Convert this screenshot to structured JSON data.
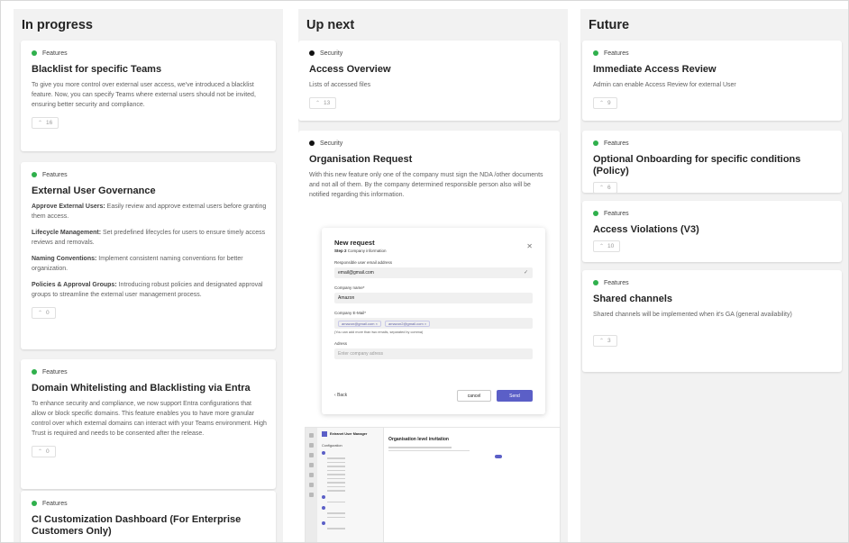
{
  "columns": [
    {
      "title": "In progress",
      "cards": [
        {
          "tag": "Features",
          "title": "Blacklist for specific Teams",
          "description": "To give you more control over external user access, we've introduced a blacklist feature. Now, you can specify Teams where external users should not be invited, ensuring better security and compliance.",
          "votes": "16"
        },
        {
          "tag": "Features",
          "title": "External User Governance",
          "paragraphs": [
            {
              "bold": "Approve External Users:",
              "text": " Easily review and approve external users before granting them access."
            },
            {
              "bold": "Lifecycle Management:",
              "text": " Set predefined lifecycles for users to ensure timely access reviews and removals."
            },
            {
              "bold": "Naming Conventions:",
              "text": " Implement consistent naming conventions for better organization."
            },
            {
              "bold": "Policies & Approval Groups:",
              "text": " Introducing robust policies and designated approval groups to streamline the external user management process."
            }
          ],
          "votes": "0"
        },
        {
          "tag": "Features",
          "title": "Domain Whitelisting and Blacklisting via Entra",
          "description": "To enhance security and compliance, we now support Entra configurations that allow or block specific domains. This feature enables you to have more granular control over which external domains can interact with your Teams environment. High Trust is required and needs to be consented after the release.",
          "votes": "0"
        },
        {
          "tag": "Features",
          "title": "CI Customization Dashboard (For Enterprise Customers Only)"
        }
      ]
    },
    {
      "title": "Up next",
      "cards": [
        {
          "tag": "Security",
          "title": "Access Overview",
          "description": "Lists of accessed files",
          "votes": "13"
        },
        {
          "tag": "Security",
          "title": "Organisation Request",
          "description": "With this new feature only one of the company must sign the NDA /other documents and not all of them. By the company determined responsible person also will be notified regarding this information.",
          "modal": {
            "title": "New request",
            "step_bold": "Step 2",
            "step_text": "Company information",
            "email_label": "Responsible user email address",
            "email_value": "email@gmail.com",
            "company_label": "Company name*",
            "company_value": "Amazon",
            "emails_label": "Company E-Mail*",
            "chip1": "amazon@gmail.com",
            "chip2": "amazon2@gmail.com",
            "emails_hint": "(You can add more than two emails, separated by comma)",
            "address_label": "Adress",
            "address_placeholder": "Enter company adress",
            "back": "Back",
            "cancel": "cancel",
            "send": "Send"
          },
          "app": {
            "brand": "Extranet User Manager",
            "section": "Configuration",
            "main_title": "Organisation level invitation"
          }
        }
      ]
    },
    {
      "title": "Future",
      "cards": [
        {
          "tag": "Features",
          "title": "Immediate Access Review",
          "description": "Admin can enable Access Review for external User",
          "votes": "9"
        },
        {
          "tag": "Features",
          "title": "Optional Onboarding for specific conditions (Policy)",
          "votes": "6"
        },
        {
          "tag": "Features",
          "title": "Access Violations (V3)",
          "votes": "10"
        },
        {
          "tag": "Features",
          "title": "Shared channels",
          "description": "Shared channels will be implemented when it's GA (general availability)",
          "votes": "3"
        }
      ]
    }
  ],
  "colors": {
    "features_dot": "#2fb04c",
    "security_dot": "#111111",
    "accent": "#5b5fc7",
    "column_bg": "#f2f2f2"
  },
  "icons": {
    "vote": "chevron-up-icon",
    "close": "close-icon",
    "check": "check-icon"
  }
}
